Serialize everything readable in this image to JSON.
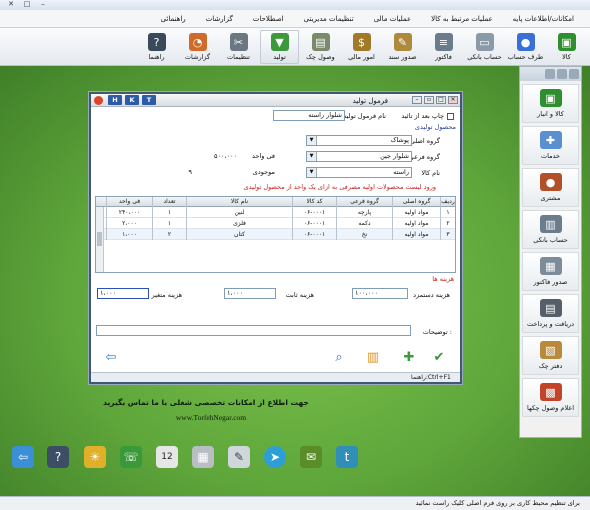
{
  "menu": [
    "امکانات/اطلاعات پایه",
    "عملیات مرتبط به کالا",
    "عملیات مالی",
    "تنظیمات مدیریتی",
    "اصطلاحات",
    "گزارشات",
    "راهنمائی"
  ],
  "ribbon": [
    {
      "label": "کالا",
      "icon": "goods-icon",
      "color": "#2f8f2f"
    },
    {
      "label": "طرف حساب",
      "icon": "person-icon",
      "color": "#3a6fd8"
    },
    {
      "label": "حساب بانکی",
      "icon": "bank-card-icon",
      "color": "#8a9aa8"
    },
    {
      "label": "فاکتور",
      "icon": "invoice-icon",
      "color": "#6a7b8c"
    },
    {
      "label": "صدور سند",
      "icon": "document-pen-icon",
      "color": "#b08a3c"
    },
    {
      "label": "امور مالی",
      "icon": "finance-icon",
      "color": "#a07a2a"
    },
    {
      "label": "وصول چک",
      "icon": "cheque-icon",
      "color": "#7a8a6a"
    },
    {
      "label": "تولید",
      "icon": "production-icon",
      "color": "#3c9a3c"
    },
    {
      "label": "تنظیمات",
      "icon": "settings-tools-icon",
      "color": "#6d7782"
    },
    {
      "label": "گزارشات",
      "icon": "reports-chart-icon",
      "color": "#d06a2a"
    },
    {
      "label": "راهنما",
      "icon": "help-icon",
      "color": "#3b4a5a"
    }
  ],
  "sidebar": [
    {
      "label": "کالا و انبار",
      "icon": "goods-warehouse-icon",
      "color": "#2f8f2f"
    },
    {
      "label": "خدمات",
      "icon": "services-icon",
      "color": "#5a8fd0"
    },
    {
      "label": "مشتری",
      "icon": "customer-icon",
      "color": "#b2502a"
    },
    {
      "label": "حساب بانکی",
      "icon": "bank-icon",
      "color": "#6b7c8d"
    },
    {
      "label": "صدور فاکتور",
      "icon": "invoice-issue-icon",
      "color": "#7d8c9a"
    },
    {
      "label": "دریافت و پرداخت",
      "icon": "payment-icon",
      "color": "#555f69"
    },
    {
      "label": "دفتر چک",
      "icon": "chequebook-icon",
      "color": "#b98a3a"
    },
    {
      "label": "اعلام وصول چکها",
      "icon": "cheque-receipt-icon",
      "color": "#c2452a"
    }
  ],
  "dialog": {
    "title": "فرمول تولید",
    "hk": [
      "T",
      "K",
      "H"
    ],
    "print_after_confirm": "چاپ بعد از تائید",
    "formula_name_label": "نام فرمول تولید",
    "formula_name_value": "شلوار راسته",
    "product_section": "محصول تولیدی",
    "main_group_label": "گروه اصلی",
    "main_group_value": "پوشاک",
    "sub_group_label": "گروه فرعی",
    "sub_group_value": "شلوار جین",
    "goods_name_label": "نام کالا",
    "goods_name_value": "راسته",
    "unit_price_label": "فی واحد",
    "unit_price_value": "۵۰۰،۰۰۰",
    "stock_label": "موجودی",
    "stock_value": "۹",
    "materials_heading": "ورود لیست محصولات اولیه مصرفی به ازای یک واحد از محصول تولیدی",
    "columns": [
      "ردیف",
      "گروه اصلی",
      "گروه فرعی",
      "کد کالا",
      "نام کالا",
      "تعداد",
      "فی واحد"
    ],
    "rows": [
      [
        "۱",
        "مواد اولیه",
        "پارچه",
        "۰۶-۰۰۰۱",
        "لنین",
        "۱",
        "۲۴۰،۰۰۰"
      ],
      [
        "۲",
        "مواد اولیه",
        "دکمه",
        "۰۶-۰۰۰۱",
        "فلزی",
        "۱",
        "۲،۰۰۰"
      ],
      [
        "۳",
        "مواد اولیه",
        "نخ",
        "۰۶-۰۰۰۱",
        "کتان",
        "۲",
        "۱،۰۰۰"
      ]
    ],
    "costs_section": "هزینه ها",
    "labor_cost_label": "هزینه دستمزد",
    "labor_cost_value": "۱۰۰،۰۰۰",
    "fixed_cost_label": "هزینه ثابت",
    "fixed_cost_value": "۱،۰۰۰",
    "variable_cost_label": "هزینه متغیر",
    "variable_cost_value": "۱،۰۰۰",
    "notes_label": "توضیحات :",
    "help_hint": "راهنما:Ctrl+F1"
  },
  "promo": {
    "line1": "جهت اطلاع از امکانات تخصصی شغلی با ما تماس بگیرید",
    "line2": "www.TorfehNegar.com"
  },
  "dock": [
    {
      "icon": "exit-icon",
      "color": "#3b8fd6"
    },
    {
      "icon": "help-icon",
      "color": "#3c4e66"
    },
    {
      "icon": "weather-icon",
      "color": "#e0b02a"
    },
    {
      "icon": "phone-icon",
      "color": "#3a9a3a"
    },
    {
      "icon": "calendar-icon",
      "color": "#e6e6e6",
      "text": "12"
    },
    {
      "icon": "calculator-icon",
      "color": "#b8bec4"
    },
    {
      "icon": "notepad-icon",
      "color": "#cfd6dc"
    },
    {
      "icon": "telegram-icon",
      "color": "#2c9fd8"
    },
    {
      "icon": "mail-icon",
      "color": "#5a8d2a"
    },
    {
      "icon": "brand-logo-icon",
      "color": "#2f8fb8"
    }
  ],
  "status_text": "برای تنظیم محیط کاری بر روی فرم اصلی کلیک راست نمائید"
}
